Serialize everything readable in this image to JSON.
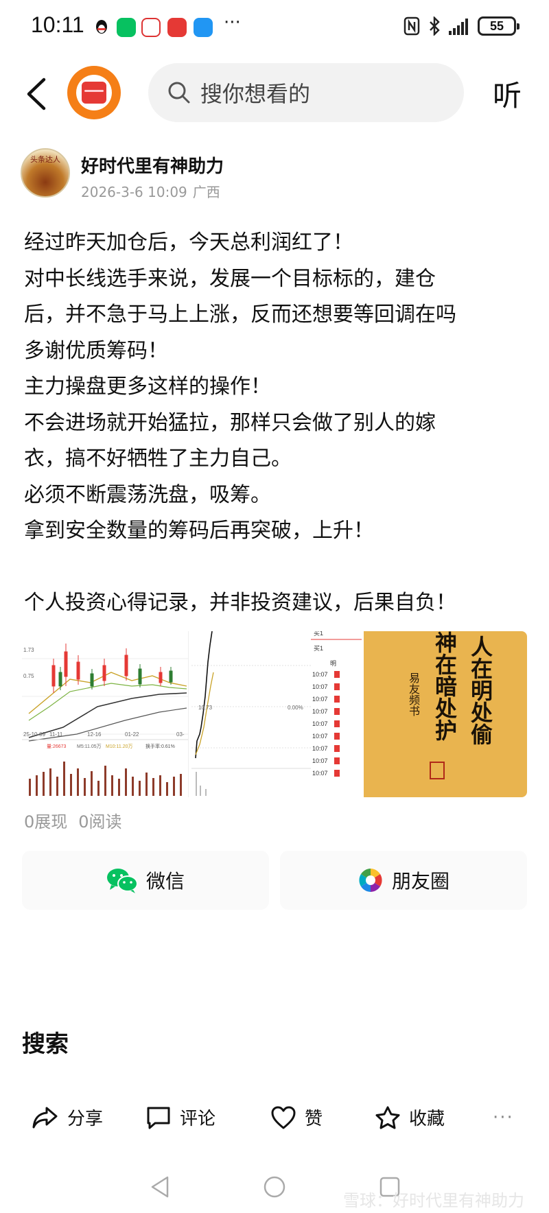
{
  "status_bar": {
    "time": "10:11",
    "battery": "55"
  },
  "header": {
    "search_placeholder": "搜你想看的",
    "listen_label": "听"
  },
  "author": {
    "name": "好时代里有神助力",
    "date": "2026-3-6 10:09",
    "location": "广西",
    "avatar_text": "头条达人"
  },
  "post": {
    "lines": [
      "经过昨天加仓后，今天总利润红了！",
      "对中长线选手来说，发展一个目标标的，建仓",
      "后，并不急于马上上涨，反而还想要等回调在吗",
      "多谢优质筹码！",
      "主力操盘更多这样的操作！",
      "不会进场就开始猛拉，那样只会做了别人的嫁",
      "衣，搞不好牺牲了主力自己。",
      "必须不断震荡洗盘，吸筹。",
      "拿到安全数量的筹码后再突破，上升！",
      "",
      "个人投资心得记录，并非投资建议，后果自负！"
    ]
  },
  "images": {
    "chart1": {
      "y_labels": [
        "1.73",
        "0.75"
      ],
      "x_labels": [
        "25-10-09",
        "11-11",
        "12-16",
        "01-22",
        "03-"
      ],
      "volume_label": "量:26673",
      "ma_label": "M5:11.05万",
      "ma10_label": "M10:11.20万",
      "turnover_label": "换手率:0.61%"
    },
    "chart2": {
      "price_label": "10.73",
      "pct_label": "0.00%"
    },
    "orderbook": {
      "top_labels": [
        "买1",
        "明"
      ],
      "times": [
        "10:07",
        "10:07",
        "10:07",
        "10:07",
        "10:07",
        "10:07",
        "10:07",
        "10:07",
        "10:07"
      ]
    },
    "calligraphy": {
      "right_col": "人在明处偷",
      "left_col": "神在暗处护",
      "small_col": "易友频书"
    }
  },
  "stats": {
    "impressions": "0展现",
    "reads": "0阅读"
  },
  "share": {
    "wechat": "微信",
    "moments": "朋友圈"
  },
  "search_heading": "搜索",
  "actions": {
    "share": "分享",
    "comment": "评论",
    "like": "赞",
    "favorite": "收藏",
    "more": "···"
  },
  "watermark": "雪球：好时代里有神助力",
  "colors": {
    "brand_orange": "#f57f17",
    "up_red": "#e53935",
    "wechat_green": "#07c160",
    "calligraphy_bg": "#e9b44f"
  }
}
